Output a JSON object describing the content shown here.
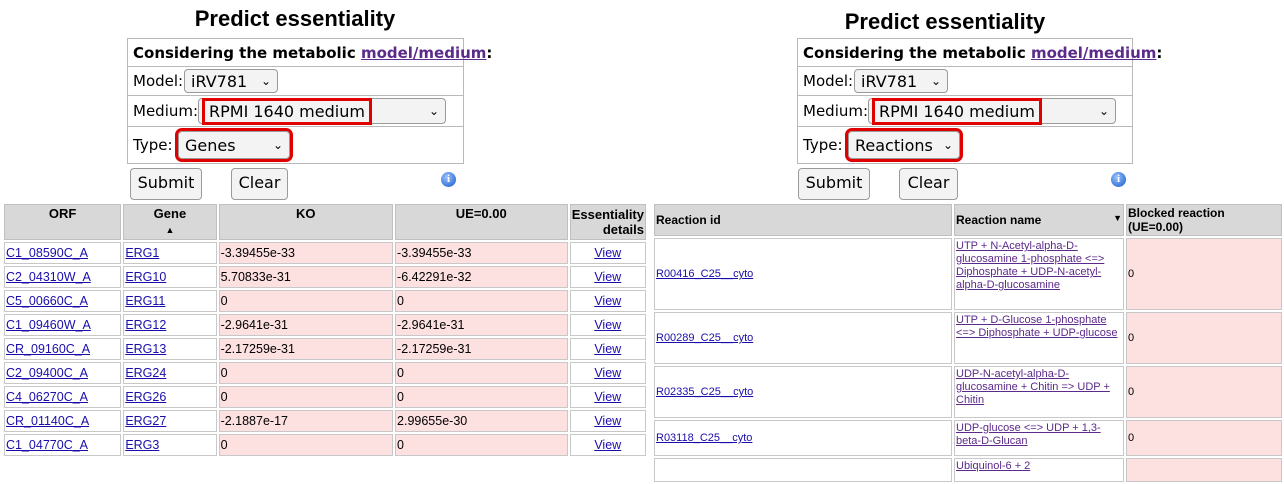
{
  "left": {
    "title": "Predict essentiality",
    "considering_label": "Considering the metabolic ",
    "considering_link": "model/medium",
    "considering_colon": ":",
    "model_label": "Model:",
    "model_value": "iRV781",
    "medium_label": "Medium:",
    "medium_value": "RPMI 1640 medium",
    "type_label": "Type:",
    "type_value": "Genes",
    "submit_label": "Submit",
    "clear_label": "Clear",
    "table": {
      "headers": [
        "ORF",
        "Gene",
        "KO",
        "UE=0.00",
        "Essentiality details"
      ],
      "rows": [
        {
          "orf": "C1_08590C_A",
          "gene": "ERG1",
          "ko": "-3.39455e-33",
          "ue": "-3.39455e-33",
          "details": "View"
        },
        {
          "orf": "C2_04310W_A",
          "gene": "ERG10",
          "ko": "5.70833e-31",
          "ue": "-6.42291e-32",
          "details": "View"
        },
        {
          "orf": "C5_00660C_A",
          "gene": "ERG11",
          "ko": "0",
          "ue": "0",
          "details": "View"
        },
        {
          "orf": "C1_09460W_A",
          "gene": "ERG12",
          "ko": "-2.9641e-31",
          "ue": "-2.9641e-31",
          "details": "View"
        },
        {
          "orf": "CR_09160C_A",
          "gene": "ERG13",
          "ko": "-2.17259e-31",
          "ue": "-2.17259e-31",
          "details": "View"
        },
        {
          "orf": "C2_09400C_A",
          "gene": "ERG24",
          "ko": "0",
          "ue": "0",
          "details": "View"
        },
        {
          "orf": "C4_06270C_A",
          "gene": "ERG26",
          "ko": "0",
          "ue": "0",
          "details": "View"
        },
        {
          "orf": "CR_01140C_A",
          "gene": "ERG27",
          "ko": "-2.1887e-17",
          "ue": "2.99655e-30",
          "details": "View"
        },
        {
          "orf": "C1_04770C_A",
          "gene": "ERG3",
          "ko": "0",
          "ue": "0",
          "details": "View"
        }
      ]
    }
  },
  "right": {
    "title": "Predict essentiality",
    "considering_label": "Considering the metabolic ",
    "considering_link": "model/medium",
    "considering_colon": ":",
    "model_label": "Model:",
    "model_value": "iRV781",
    "medium_label": "Medium:",
    "medium_value": "RPMI 1640 medium",
    "type_label": "Type:",
    "type_value": "Reactions",
    "submit_label": "Submit",
    "clear_label": "Clear",
    "table": {
      "headers": [
        "Reaction id",
        "Reaction name",
        "Blocked reaction (UE=0.00)"
      ],
      "rows": [
        {
          "id": "R00416_C25__cyto",
          "name": "UTP + N-Acetyl-alpha-D-glucosamine 1-phosphate <=> Diphosphate + UDP-N-acetyl-alpha-D-glucosamine",
          "blocked": "0"
        },
        {
          "id": "R00289_C25__cyto",
          "name": "UTP + D-Glucose 1-phosphate <=> Diphosphate + UDP-glucose",
          "blocked": "0"
        },
        {
          "id": "R02335_C25__cyto",
          "name": "UDP-N-acetyl-alpha-D-glucosamine + Chitin => UDP + Chitin",
          "blocked": "0"
        },
        {
          "id": "R03118_C25__cyto",
          "name": "UDP-glucose <=> UDP + 1,3-beta-D-Glucan",
          "blocked": "0"
        },
        {
          "id": "",
          "name": "Ubiquinol-6 + 2",
          "blocked": ""
        }
      ]
    }
  },
  "colors": {
    "link": "#1a0dab",
    "visited_link": "#5b2a8a",
    "highlight_box": "#e00000",
    "cell_pink": "#fde0e0",
    "header_gray": "#d8d8d8"
  },
  "icons": [
    "info-icon",
    "chevron-down-icon",
    "sort-ascending-icon"
  ]
}
